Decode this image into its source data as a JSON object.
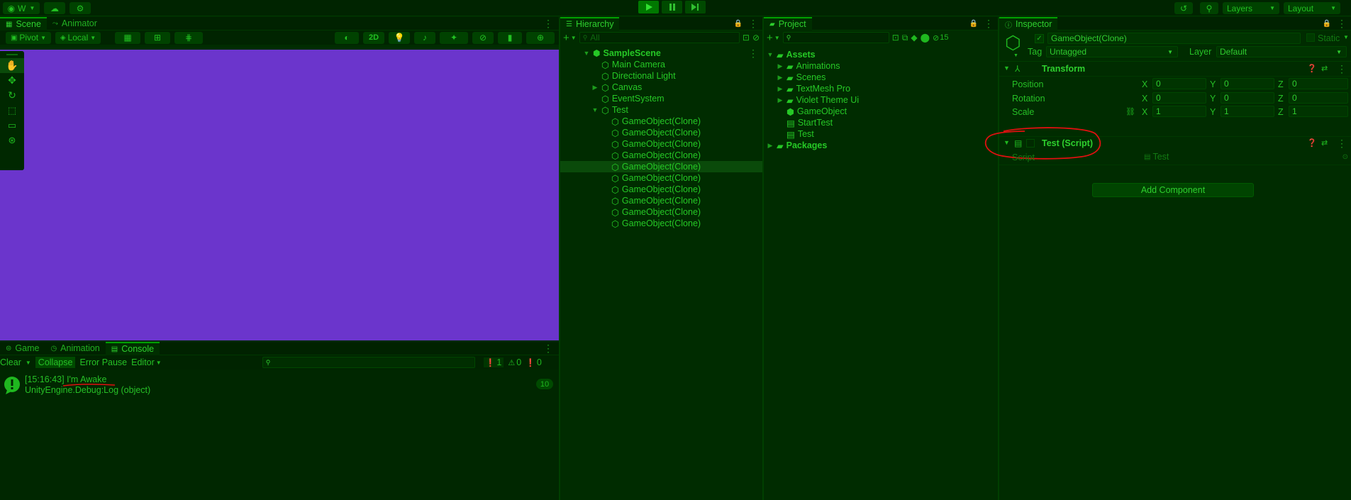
{
  "colors": {
    "scene_bg": "#6b35cc",
    "accent": "#00a000",
    "annotation": "#e01010"
  },
  "topbar": {
    "account_label": "W",
    "layers_label": "Layers",
    "layout_label": "Layout"
  },
  "scene": {
    "tabs": [
      "Scene",
      "Animator"
    ],
    "pivot_label": "Pivot",
    "local_label": "Local",
    "mode_2d": "2D"
  },
  "hierarchy": {
    "tab": "Hierarchy",
    "search_placeholder": "All",
    "scene_name": "SampleScene",
    "items": [
      "Main Camera",
      "Directional Light",
      "Canvas",
      "EventSystem",
      "Test"
    ],
    "children": [
      "GameObject(Clone)",
      "GameObject(Clone)",
      "GameObject(Clone)",
      "GameObject(Clone)",
      "GameObject(Clone)",
      "GameObject(Clone)",
      "GameObject(Clone)",
      "GameObject(Clone)",
      "GameObject(Clone)",
      "GameObject(Clone)"
    ],
    "selected_index": 4
  },
  "project": {
    "tab": "Project",
    "hidden_count": "15",
    "assets_label": "Assets",
    "folders": [
      "Animations",
      "Scenes",
      "TextMesh Pro",
      "Violet Theme Ui"
    ],
    "files": [
      "GameObject",
      "StartTest",
      "Test"
    ],
    "packages_label": "Packages"
  },
  "inspector": {
    "tab": "Inspector",
    "object_name": "GameObject(Clone)",
    "static_label": "Static",
    "tag_label": "Tag",
    "tag_value": "Untagged",
    "layer_label": "Layer",
    "layer_value": "Default",
    "transform_title": "Transform",
    "position_label": "Position",
    "rotation_label": "Rotation",
    "scale_label": "Scale",
    "axis": [
      "X",
      "Y",
      "Z"
    ],
    "position": [
      "0",
      "0",
      "0"
    ],
    "rotation": [
      "0",
      "0",
      "0"
    ],
    "scale": [
      "1",
      "1",
      "1"
    ],
    "script_component_title": "Test (Script)",
    "script_label": "Script",
    "script_value": "Test",
    "add_component_label": "Add Component"
  },
  "console": {
    "tabs": [
      "Game",
      "Animation",
      "Console"
    ],
    "clear_label": "Clear",
    "collapse_label": "Collapse",
    "error_pause_label": "Error Pause",
    "editor_label": "Editor",
    "info_count": "1",
    "warn_count": "0",
    "error_count": "0",
    "log_line1": "[15:16:43] I'm Awake",
    "log_line2": "UnityEngine.Debug:Log (object)",
    "log_count": "10"
  }
}
